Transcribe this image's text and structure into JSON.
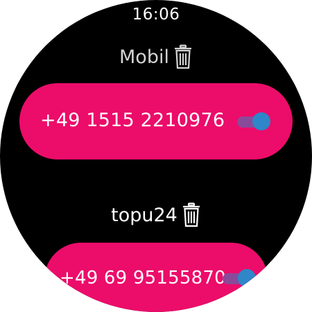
{
  "status_bar": {
    "time": "16:06"
  },
  "entries": [
    {
      "label": "Mobil",
      "number": "+49 1515 2210976",
      "enabled": true,
      "icon": "trash-icon"
    },
    {
      "label": "topu24",
      "number": "+49 69 95155870",
      "enabled": true,
      "icon": "trash-icon"
    }
  ],
  "colors": {
    "background": "#000000",
    "pill": "#ec0c6a",
    "toggle_thumb": "#2f86c8",
    "toggle_track": "#8a4a9a"
  }
}
